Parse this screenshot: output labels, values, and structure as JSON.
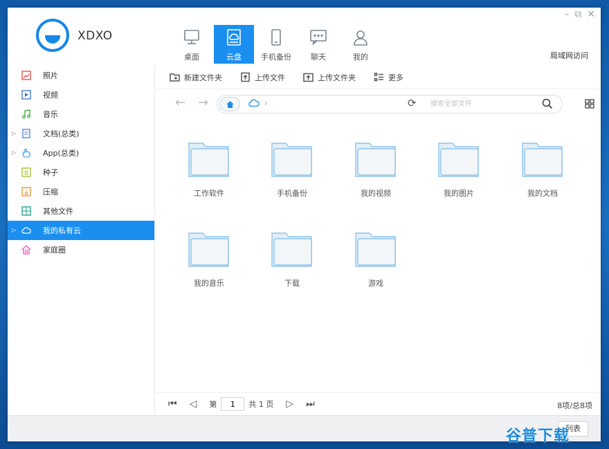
{
  "window": {
    "controls": [
      "–",
      "⧉",
      "✕"
    ]
  },
  "header": {
    "logo_text": "XDXO",
    "lan_link": "局域网访问",
    "nav": [
      {
        "label": "桌面",
        "icon": "monitor-icon",
        "active": false
      },
      {
        "label": "云盘",
        "icon": "cloud-drive-icon",
        "active": true
      },
      {
        "label": "手机备份",
        "icon": "phone-icon",
        "active": false
      },
      {
        "label": "聊天",
        "icon": "chat-icon",
        "active": false
      },
      {
        "label": "我的",
        "icon": "user-icon",
        "active": false
      }
    ]
  },
  "sidebar": {
    "items": [
      {
        "label": "照片",
        "icon": "photo-icon",
        "color": "#e8453c"
      },
      {
        "label": "视频",
        "icon": "video-icon",
        "color": "#3b6fd8"
      },
      {
        "label": "音乐",
        "icon": "music-icon",
        "color": "#3aa53a"
      },
      {
        "label": "文档(总类)",
        "icon": "document-icon",
        "color": "#4a7bd0",
        "expandable": true
      },
      {
        "label": "App(总类)",
        "icon": "app-icon",
        "color": "#2d8de8",
        "expandable": true
      },
      {
        "label": "种子",
        "icon": "torrent-icon",
        "color": "#9bc02a"
      },
      {
        "label": "压缩",
        "icon": "archive-icon",
        "color": "#e89420"
      },
      {
        "label": "其他文件",
        "icon": "other-files-icon",
        "color": "#1a9e8f"
      },
      {
        "label": "我的私有云",
        "icon": "cloud-icon",
        "color": "#ffffff",
        "expandable": true,
        "active": true
      },
      {
        "label": "家庭圈",
        "icon": "home-icon",
        "color": "#e85cb0"
      }
    ]
  },
  "toolbar": {
    "new_folder": "新建文件夹",
    "upload_file": "上传文件",
    "upload_folder": "上传文件夹",
    "more": "更多"
  },
  "address": {
    "back": "←",
    "forward": "→",
    "separator": "›",
    "refresh": "⟳",
    "search_placeholder": "搜索全部文件"
  },
  "folders": [
    {
      "label": "工作软件"
    },
    {
      "label": "手机备份"
    },
    {
      "label": "我的视频"
    },
    {
      "label": "我的图片"
    },
    {
      "label": "我的文档"
    },
    {
      "label": "我的音乐"
    },
    {
      "label": "下载"
    },
    {
      "label": "游戏"
    }
  ],
  "pager": {
    "first": "⏮",
    "prev": "◁",
    "page_prefix": "第",
    "page_value": "1",
    "total": "共 1 页",
    "next": "▷",
    "last": "⏭",
    "count": "8项/总8项"
  },
  "footer": {
    "button_label": "列表"
  },
  "watermark": "谷普下载",
  "colors": {
    "accent": "#1a8ff0",
    "folder_fill": "#f3f6f8",
    "folder_stroke": "#8ec3ea"
  }
}
